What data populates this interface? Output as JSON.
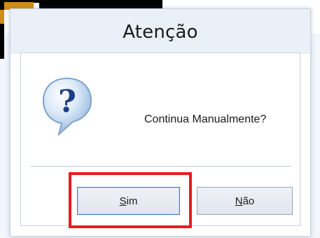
{
  "dialog": {
    "title": "Atenção",
    "message": "Continua Manualmente?",
    "icon": "question-icon"
  },
  "buttons": {
    "yes": {
      "mnemonic": "S",
      "rest": "im"
    },
    "no": {
      "mnemonic": "N",
      "rest": "ão"
    }
  },
  "colors": {
    "highlight": "#ea1a22",
    "focused_border": "#3c7fcf"
  }
}
